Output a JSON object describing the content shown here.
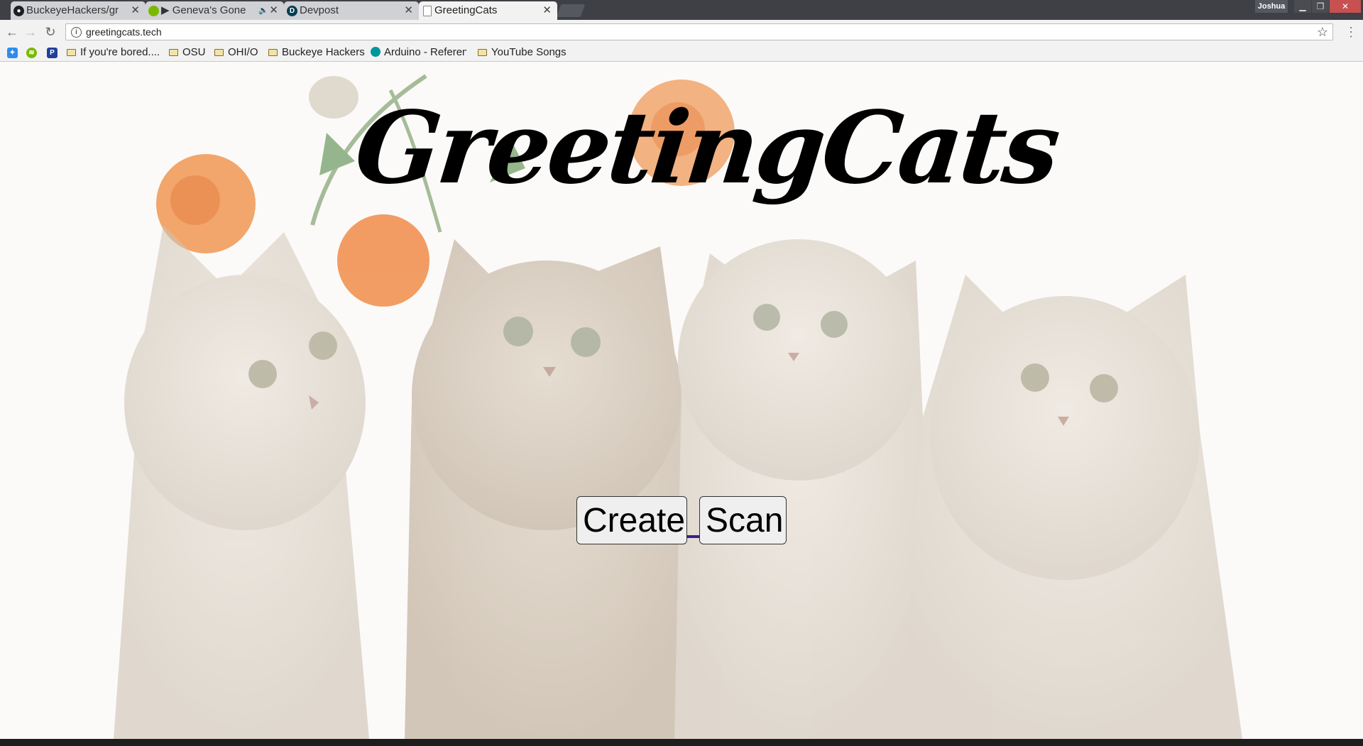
{
  "browser": {
    "tabs": [
      {
        "title": "BuckeyeHackers/gr",
        "favicon": "github-icon"
      },
      {
        "title": "▶ Geneva's Gone",
        "favicon": "spotify-icon",
        "audio": "🔈"
      },
      {
        "title": "Devpost",
        "favicon": "devpost-icon",
        "favicon_text": "D"
      },
      {
        "title": "GreetingCats",
        "favicon": "page-icon",
        "active": true
      }
    ],
    "close_glyph": "✕",
    "profile_name": "Joshua",
    "url": "greetingcats.tech",
    "bookmarks": [
      {
        "label": "If you're bored....",
        "icon": "folder-icon"
      },
      {
        "label": "OSU",
        "icon": "folder-icon"
      },
      {
        "label": "OHI/O",
        "icon": "folder-icon"
      },
      {
        "label": "Buckeye Hackers",
        "icon": "folder-icon"
      },
      {
        "label": "Arduino - Referen",
        "icon": "arduino-icon"
      },
      {
        "label": "YouTube Songs",
        "icon": "folder-icon"
      }
    ],
    "bookmark_app_icons": [
      {
        "name": "dropbox-icon",
        "color": "#2d8cf0"
      },
      {
        "name": "spotify-icon",
        "color": "#7ab800"
      },
      {
        "name": "pandora-icon",
        "color": "#224099",
        "text": "P"
      }
    ]
  },
  "page": {
    "title": "GreetingCats",
    "create_label": "Create",
    "scan_label": "Scan"
  },
  "colors": {
    "tabstrip": "#3e4046",
    "toolbar": "#f2f2f2",
    "connector": "#3b1e8c"
  }
}
